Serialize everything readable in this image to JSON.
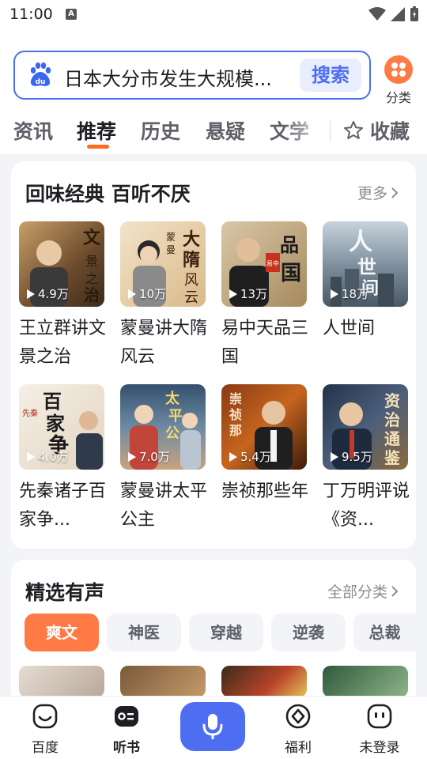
{
  "status_bar": {
    "time": "11:00",
    "a_badge": "A"
  },
  "search": {
    "query": "日本大分市发生大规模...",
    "button_label": "搜索",
    "category_label": "分类"
  },
  "tabs": [
    {
      "label": "资讯"
    },
    {
      "label": "推荐"
    },
    {
      "label": "历史"
    },
    {
      "label": "悬疑"
    },
    {
      "label": "文学"
    }
  ],
  "favorites_label": "收藏",
  "classics": {
    "title": "回味经典 百听不厌",
    "more_label": "更多",
    "books": [
      {
        "title": "王立群讲文景之治",
        "plays": "4.9万",
        "cover_text": "文景之治"
      },
      {
        "title": "蒙曼讲大隋风云",
        "plays": "10万",
        "cover_text": "大隋风云"
      },
      {
        "title": "易中天品三国",
        "plays": "13万",
        "cover_text": "品三国"
      },
      {
        "title": "人世间",
        "plays": "18万",
        "cover_text": "人世间"
      },
      {
        "title": "先秦诸子百家争...",
        "plays": "4.0万",
        "cover_text": "百家争鸣"
      },
      {
        "title": "蒙曼讲太平公主",
        "plays": "7.0万",
        "cover_text": "太平公主"
      },
      {
        "title": "崇祯那些年",
        "plays": "5.4万",
        "cover_text": "崇祯那些"
      },
      {
        "title": "丁万明评说《资...",
        "plays": "9.5万",
        "cover_text": "资治通鉴"
      }
    ]
  },
  "selected": {
    "title": "精选有声",
    "more_label": "全部分类",
    "chips": [
      "爽文",
      "神医",
      "穿越",
      "逆袭",
      "总裁"
    ]
  },
  "bottom_nav": {
    "items": [
      {
        "label": "百度"
      },
      {
        "label": "听书"
      },
      {
        "label": "福利"
      },
      {
        "label": "未登录"
      }
    ]
  },
  "colors": {
    "accent": "#4e6ef2",
    "orange": "#ff7a45",
    "tab_indicator": "#ff6a1f"
  }
}
